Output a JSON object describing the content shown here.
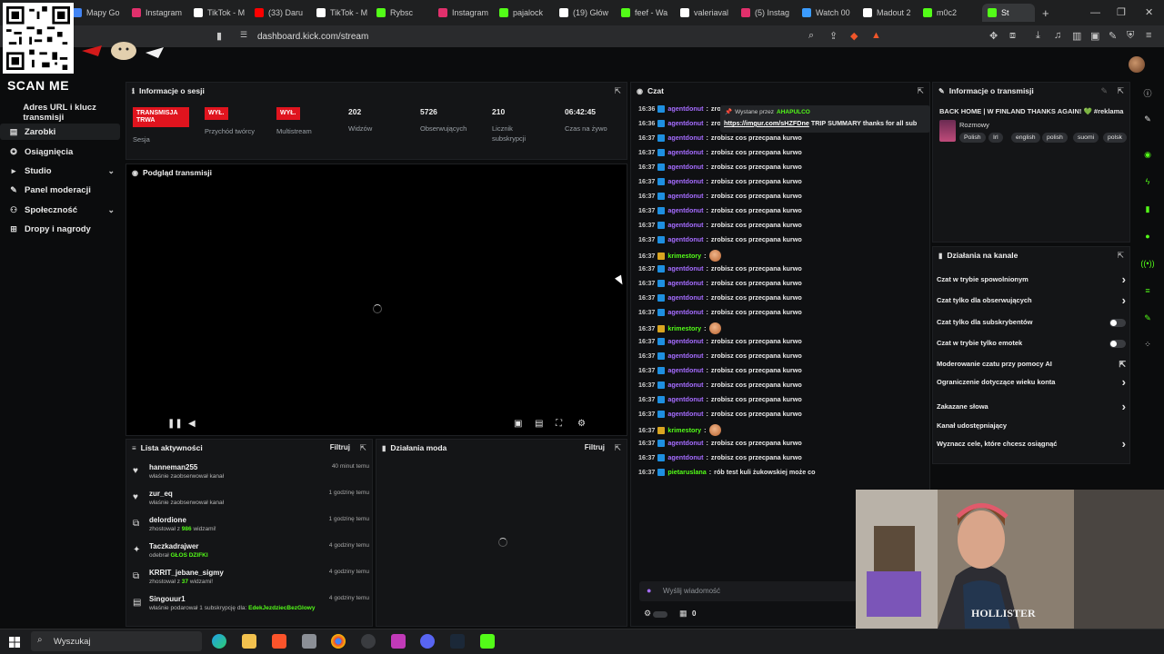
{
  "browser": {
    "tabs": [
      {
        "label": "Mapy Go",
        "color": "#4285f4"
      },
      {
        "label": "Instagram",
        "color": "#e1306c"
      },
      {
        "label": "TikTok - M",
        "color": "#ffffff"
      },
      {
        "label": "(33) Daru",
        "color": "#ff0000"
      },
      {
        "label": "TikTok - M",
        "color": "#ffffff"
      },
      {
        "label": "Rybsc",
        "color": "#53fc18"
      },
      {
        "label": "Instagram",
        "color": "#e1306c"
      },
      {
        "label": "pajalock",
        "color": "#53fc18"
      },
      {
        "label": "(19) Głów",
        "color": "#ffffff"
      },
      {
        "label": "feef - Wa",
        "color": "#53fc18"
      },
      {
        "label": "valeriaval",
        "color": "#ffffff"
      },
      {
        "label": "(5) Instag",
        "color": "#e1306c"
      },
      {
        "label": "Watch 00",
        "color": "#3b9cff"
      },
      {
        "label": "Madout 2",
        "color": "#ffffff"
      },
      {
        "label": "m0c2",
        "color": "#53fc18"
      },
      {
        "label": "St",
        "color": "#53fc18"
      }
    ],
    "url": "dashboard.kick.com/stream",
    "new_tab": "+"
  },
  "overlay": {
    "scan_me": "SCAN ME"
  },
  "sidebar": {
    "items": [
      {
        "label": "Adres URL i klucz transmisji",
        "icon": "key-icon"
      },
      {
        "label": "Zarobki",
        "icon": "wallet-icon"
      },
      {
        "label": "Osiągnięcia",
        "icon": "trophy-icon"
      },
      {
        "label": "Studio",
        "icon": "studio-icon"
      },
      {
        "label": "Panel moderacji",
        "icon": "shield-icon"
      },
      {
        "label": "Społeczność",
        "icon": "people-icon"
      },
      {
        "label": "Dropy i nagrody",
        "icon": "gift-icon"
      }
    ]
  },
  "session": {
    "title": "Informacje o sesji",
    "live_badge": "TRANSMISJA TRWA",
    "live_label": "Sesja",
    "creator_badge": "WYŁ.",
    "creator_label": "Przychód twórcy",
    "multi_badge": "WYŁ.",
    "multi_label": "Multistream",
    "viewers": "202",
    "viewers_label": "Widzów",
    "followers": "5726",
    "followers_label": "Obserwujących",
    "subs": "210",
    "subs_label": "Licznik subskrypcji",
    "uptime": "06:42:45",
    "uptime_label": "Czas na żywo"
  },
  "preview": {
    "title": "Podgląd transmisji"
  },
  "activity": {
    "title": "Lista aktywności",
    "filter": "Filtruj",
    "items": [
      {
        "name": "hanneman255",
        "sub": "właśnie zaobserwował kanał",
        "time": "40 minut temu",
        "icon": "♥"
      },
      {
        "name": "zur_eq",
        "sub": "właśnie zaobserwował kanał",
        "time": "1 godzinę temu",
        "icon": "♥"
      },
      {
        "name": "delordione",
        "sub_a": "zhostował z ",
        "sub_b": "986",
        "sub_c": " widzami!",
        "time": "1 godzinę temu",
        "icon": "⧉"
      },
      {
        "name": "Taczkadrajwer",
        "sub_a": "odebrał ",
        "sub_b": "GŁOS DZIFKI",
        "sub_c": "",
        "time": "4 godziny temu",
        "icon": "✦"
      },
      {
        "name": "KRRIT_jebane_sigmy",
        "sub_a": "zhostował z ",
        "sub_b": "37",
        "sub_c": " widzami!",
        "time": "4 godziny temu",
        "icon": "⧉"
      },
      {
        "name": "Singouur1",
        "sub_a": "właśnie podarował 1 subskrypcję dla: ",
        "sub_b": "EdekJezdziecBezGlowy",
        "sub_c": "",
        "time": "4 godziny temu",
        "icon": "▤"
      }
    ]
  },
  "modactions": {
    "title": "Działania moda",
    "filter": "Filtruj"
  },
  "chat": {
    "title": "Czat",
    "pinned_by": "Wystane przez",
    "pinned_user": "AHAPULCO",
    "pinned_link": "https://imgur.com/sHZFDne",
    "pinned_text": " TRIP SUMMARY thanks for all sub",
    "placeholder": "Wyślij wiadomość",
    "counter": "0",
    "lines": [
      {
        "t": "16:36",
        "u": "agentdonut",
        "m": "zrobisz",
        "c": "#a56cff"
      },
      {
        "t": "16:36",
        "u": "agentdonut",
        "m": "zrobi",
        "c": "#a56cff"
      },
      {
        "t": "16:37",
        "u": "agentdonut",
        "m": "zrobisz cos przecpana kurwo",
        "c": "#a56cff"
      },
      {
        "t": "16:37",
        "u": "agentdonut",
        "m": "zrobisz cos przecpana kurwo",
        "c": "#a56cff"
      },
      {
        "t": "16:37",
        "u": "agentdonut",
        "m": "zrobisz cos przecpana kurwo",
        "c": "#a56cff"
      },
      {
        "t": "16:37",
        "u": "agentdonut",
        "m": "zrobisz cos przecpana kurwo",
        "c": "#a56cff"
      },
      {
        "t": "16:37",
        "u": "agentdonut",
        "m": "zrobisz cos przecpana kurwo",
        "c": "#a56cff"
      },
      {
        "t": "16:37",
        "u": "agentdonut",
        "m": "zrobisz cos przecpana kurwo",
        "c": "#a56cff"
      },
      {
        "t": "16:37",
        "u": "agentdonut",
        "m": "zrobisz cos przecpana kurwo",
        "c": "#a56cff"
      },
      {
        "t": "16:37",
        "u": "agentdonut",
        "m": "zrobisz cos przecpana kurwo",
        "c": "#a56cff"
      },
      {
        "t": "16:37",
        "u": "krimestory",
        "m": "",
        "c": "#53fc18",
        "emote": true
      },
      {
        "t": "16:37",
        "u": "agentdonut",
        "m": "zrobisz cos przecpana kurwo",
        "c": "#a56cff"
      },
      {
        "t": "16:37",
        "u": "agentdonut",
        "m": "zrobisz cos przecpana kurwo",
        "c": "#a56cff"
      },
      {
        "t": "16:37",
        "u": "agentdonut",
        "m": "zrobisz cos przecpana kurwo",
        "c": "#a56cff"
      },
      {
        "t": "16:37",
        "u": "agentdonut",
        "m": "zrobisz cos przecpana kurwo",
        "c": "#a56cff"
      },
      {
        "t": "16:37",
        "u": "krimestory",
        "m": "",
        "c": "#53fc18",
        "emote": true
      },
      {
        "t": "16:37",
        "u": "agentdonut",
        "m": "zrobisz cos przecpana kurwo",
        "c": "#a56cff"
      },
      {
        "t": "16:37",
        "u": "agentdonut",
        "m": "zrobisz cos przecpana kurwo",
        "c": "#a56cff"
      },
      {
        "t": "16:37",
        "u": "agentdonut",
        "m": "zrobisz cos przecpana kurwo",
        "c": "#a56cff"
      },
      {
        "t": "16:37",
        "u": "agentdonut",
        "m": "zrobisz cos przecpana kurwo",
        "c": "#a56cff"
      },
      {
        "t": "16:37",
        "u": "agentdonut",
        "m": "zrobisz cos przecpana kurwo",
        "c": "#a56cff"
      },
      {
        "t": "16:37",
        "u": "agentdonut",
        "m": "zrobisz cos przecpana kurwo",
        "c": "#a56cff"
      },
      {
        "t": "16:37",
        "u": "krimestory",
        "m": "",
        "c": "#53fc18",
        "emote": true
      },
      {
        "t": "16:37",
        "u": "agentdonut",
        "m": "zrobisz cos przecpana kurwo",
        "c": "#a56cff"
      },
      {
        "t": "16:37",
        "u": "agentdonut",
        "m": "zrobisz cos przecpana kurwo",
        "c": "#a56cff"
      },
      {
        "t": "16:37",
        "u": "pietaruslana",
        "m": "rób test kuli żukowskiej może co",
        "c": "#53fc18"
      }
    ]
  },
  "stream_info": {
    "title": "Informacje o transmisji",
    "stream_title": "BACK HOME | W FINLAND THANKS AGAIN! 💚 #reklama",
    "category": "Rozmowy",
    "tags": [
      "Polish",
      "Irl",
      "english",
      "polish",
      "suomi",
      "polsk"
    ]
  },
  "channel_actions": {
    "title": "Działania na kanale",
    "options": [
      {
        "label": "Czat w trybie spowolnionym",
        "ctl": "chevron"
      },
      {
        "label": "Czat tylko dla obserwujących",
        "ctl": "chevron"
      },
      {
        "label": "Czat tylko dla subskrybentów",
        "ctl": "toggle"
      },
      {
        "label": "Czat w trybie tylko emotek",
        "ctl": "toggle"
      },
      {
        "label": "Moderowanie czatu przy pomocy AI",
        "ctl": "external"
      },
      {
        "label": "Ograniczenie dotyczące wieku konta",
        "ctl": "chevron"
      },
      {
        "label": "Zakazane słowa",
        "ctl": "chevron"
      },
      {
        "label": "Kanał udostępniający",
        "ctl": "none"
      },
      {
        "label": "Wyznacz cele, które chcesz osiągnąć",
        "ctl": "chevron"
      }
    ]
  },
  "taskbar": {
    "search": "Wyszukaj"
  },
  "colors": {
    "accent": "#53fc18",
    "live": "#e0141e",
    "chat_user": "#a56cff"
  }
}
